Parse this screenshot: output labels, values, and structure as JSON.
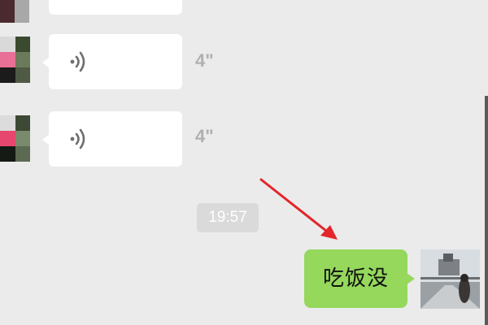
{
  "chat": {
    "messages": [
      {
        "type": "voice",
        "sender": "contact",
        "duration": "4\""
      },
      {
        "type": "voice",
        "sender": "contact",
        "duration": "4\""
      }
    ],
    "timestamp": "19:57",
    "outgoing": {
      "type": "text",
      "sender": "self",
      "text": "吃饭没"
    }
  },
  "icons": [
    "voice-wave-icon",
    "red-arrow-annotation"
  ],
  "colors": {
    "background": "#ebebeb",
    "incoming_bubble": "#ffffff",
    "outgoing_bubble": "#95d85c",
    "timestamp_pill": "#dadada",
    "duration_text": "#b0b0b0",
    "arrow": "#e3262b"
  }
}
